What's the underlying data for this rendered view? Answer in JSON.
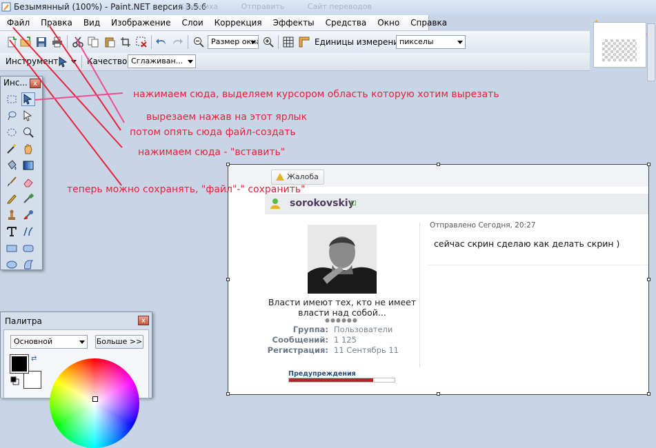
{
  "window": {
    "title": "Безымянный (100%) - Paint.NET версия 3.5.6",
    "ghost_tabs": [
      "Кумачиха",
      "Отправить",
      "Сайт переводов"
    ]
  },
  "menu": [
    "Файл",
    "Правка",
    "Вид",
    "Изображение",
    "Слои",
    "Коррекция",
    "Эффекты",
    "Средства",
    "Окно",
    "Справка"
  ],
  "toolbar": {
    "zoom_value": "Размер окна",
    "units_label": "Единицы измерения:",
    "units_value": "пикселы",
    "tool_label": "Инструмент:",
    "quality_label": "Качество:",
    "quality_value": "Сглаживан..."
  },
  "tools_window": {
    "title": "Инс...",
    "close": "x",
    "tools": [
      "rect-select",
      "move-selection",
      "lasso-select",
      "move-selected",
      "ellipse-select",
      "zoom",
      "magic-wand",
      "pan",
      "paint-bucket",
      "gradient",
      "paintbrush",
      "eraser",
      "pencil",
      "color-picker",
      "clone-stamp",
      "recolor",
      "text",
      "line-curve",
      "rectangle",
      "rounded-rectangle",
      "ellipse",
      "freeform-shape"
    ]
  },
  "palette_window": {
    "title": "Палитра",
    "close": "x",
    "mode_value": "Основной",
    "more_button": "Больше >>",
    "primary_color": "#000000",
    "secondary_color": "#ffffff"
  },
  "canvas": {
    "complain_button": "Жалоба",
    "username": "sorokovskiy",
    "sent": "Отправлено Сегодня, 20:27",
    "message": "сейчас скрин сделаю как делать скрин )",
    "quote": "Власти имеют тех, кто не имеет власти над собой...",
    "rating_dots": "●●●●●●",
    "info": [
      {
        "label": "Группа:",
        "value": "Пользователи"
      },
      {
        "label": "Сообщений:",
        "value": "1 125"
      },
      {
        "label": "Регистрация:",
        "value": "11 Сентябрь 11"
      }
    ],
    "warnings_label": "Предупреждения",
    "warnings_level": 0.8
  },
  "annotations": [
    "нажимаем сюда, выделяем курсором область которую хотим вырезать",
    "вырезаем нажав на этот ярлык",
    "потом опять сюда файл-создать",
    "нажимаем сюда - \"вставить\"",
    "теперь можно сохранять, \"файл\"-\" сохранить\""
  ],
  "colors": {
    "annotation": "#e8213b",
    "annotation_pink": "#f04b8c",
    "workspace": "#c7d5e6"
  }
}
